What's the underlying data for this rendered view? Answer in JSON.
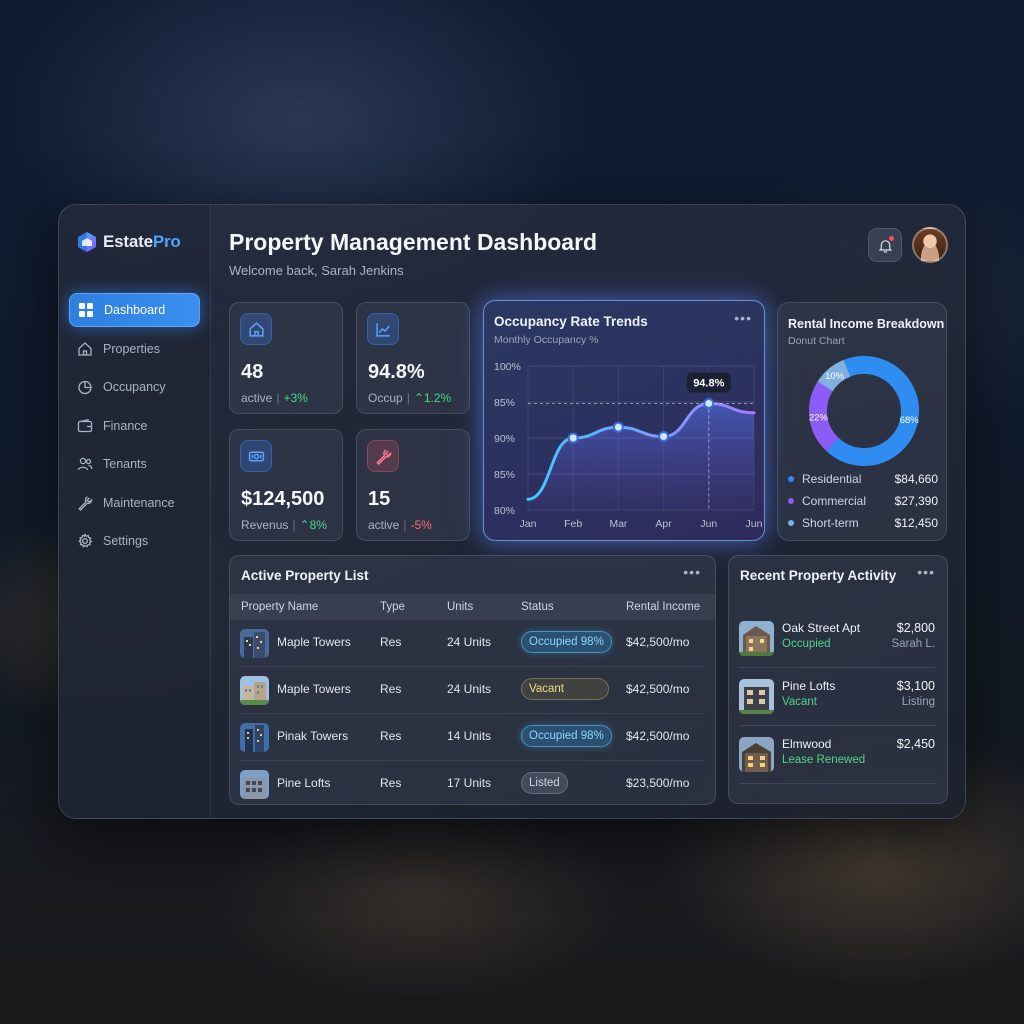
{
  "brand": {
    "name_main": "Estate",
    "name_accent": "Pro"
  },
  "header": {
    "title": "Property Management Dashboard",
    "subtitle": "Welcome back, Sarah Jenkins"
  },
  "nav": [
    {
      "label": "Dashboard",
      "icon": "grid-icon",
      "active": true
    },
    {
      "label": "Properties",
      "icon": "home-icon"
    },
    {
      "label": "Occupancy",
      "icon": "pie-icon"
    },
    {
      "label": "Finance",
      "icon": "wallet-icon"
    },
    {
      "label": "Tenants",
      "icon": "users-icon"
    },
    {
      "label": "Maintenance",
      "icon": "wrench-icon"
    },
    {
      "label": "Settings",
      "icon": "gear-icon"
    }
  ],
  "stats": [
    {
      "value": "48",
      "label": "active",
      "change": "+3%",
      "trend": "up",
      "icon": "home-icon",
      "color": "#3b82f6"
    },
    {
      "value": "94.8%",
      "label": "Occup",
      "change": "1.2%",
      "trend": "up",
      "icon": "chart-line-icon",
      "color": "#3b82f6"
    },
    {
      "value": "$124,500",
      "label": "Revenus",
      "change": "8%",
      "trend": "up",
      "icon": "money-icon",
      "color": "#3b82f6"
    },
    {
      "value": "15",
      "label": "active",
      "change": "-5%",
      "trend": "down",
      "icon": "wrench-icon",
      "color": "#e0566b"
    }
  ],
  "occupancy_card": {
    "title": "Occupancy Rate Trends",
    "subtitle": "Monthly Occupancy %",
    "more": "•••"
  },
  "income_card": {
    "title": "Rental Income Breakdown",
    "subtitle": "Donut Chart",
    "legend": [
      {
        "label": "Residential",
        "value": "$84,660",
        "color": "#2f8cf0"
      },
      {
        "label": "Commercial",
        "value": "$27,390",
        "color": "#8b5cf6"
      },
      {
        "label": "Short-term",
        "value": "$12,450",
        "color": "#7fb0e0"
      }
    ]
  },
  "chart_data": [
    {
      "type": "line",
      "title": "Occupancy Rate Trends",
      "subtitle": "Monthly Occupancy %",
      "x": [
        "Jan",
        "Feb",
        "Mar",
        "Apr",
        "Jun",
        "Jun"
      ],
      "series": [
        {
          "values": [
            81.5,
            90,
            91.5,
            90.2,
            94.8,
            93.5
          ]
        }
      ],
      "points": [
        1,
        2,
        3,
        4
      ],
      "y_ticks": [
        "100%",
        "85%",
        "90%",
        "85%",
        "80%"
      ],
      "callout": {
        "label": "94.8%",
        "index": 4,
        "value": 94.8
      },
      "reference_line": 94.8,
      "grid": true
    },
    {
      "type": "pie",
      "title": "Rental Income Breakdown",
      "subtitle": "Donut Chart",
      "categories": [
        "Residential",
        "Commercial",
        "Short-term"
      ],
      "values": [
        68,
        22,
        10
      ],
      "value_labels": [
        "68%",
        "22%",
        "10%"
      ]
    }
  ],
  "property_table": {
    "title": "Active Property List",
    "more": "•••",
    "columns": [
      "Property Name",
      "Type",
      "Units",
      "Status",
      "Rental Income"
    ],
    "rows": [
      {
        "name": "Maple Towers",
        "type": "Res",
        "units": "24 Units",
        "status": "Occupied 98%",
        "status_kind": "occupied",
        "income": "$42,500/mo"
      },
      {
        "name": "Maple Towers",
        "type": "Res",
        "units": "24 Units",
        "status": "Vacant",
        "status_kind": "vacant",
        "income": "$42,500/mo"
      },
      {
        "name": "Pinak Towers",
        "type": "Res",
        "units": "14 Units",
        "status": "Occupied 98%",
        "status_kind": "occupied",
        "income": "$42,500/mo"
      },
      {
        "name": "Pine Lofts",
        "type": "Res",
        "units": "17 Units",
        "status": "Listed",
        "status_kind": "listed",
        "income": "$23,500/mo"
      }
    ]
  },
  "activity": {
    "title": "Recent Property Activity",
    "more": "•••",
    "items": [
      {
        "name": "Oak Street Apt",
        "status": "Occupied",
        "amount": "$2,800",
        "sub": "Sarah L."
      },
      {
        "name": "Pine Lofts",
        "status": "Vacant",
        "amount": "$3,100",
        "sub": "Listing"
      },
      {
        "name": "Elmwood",
        "status": "Lease Renewed",
        "amount": "$2,450",
        "sub": ""
      }
    ]
  }
}
